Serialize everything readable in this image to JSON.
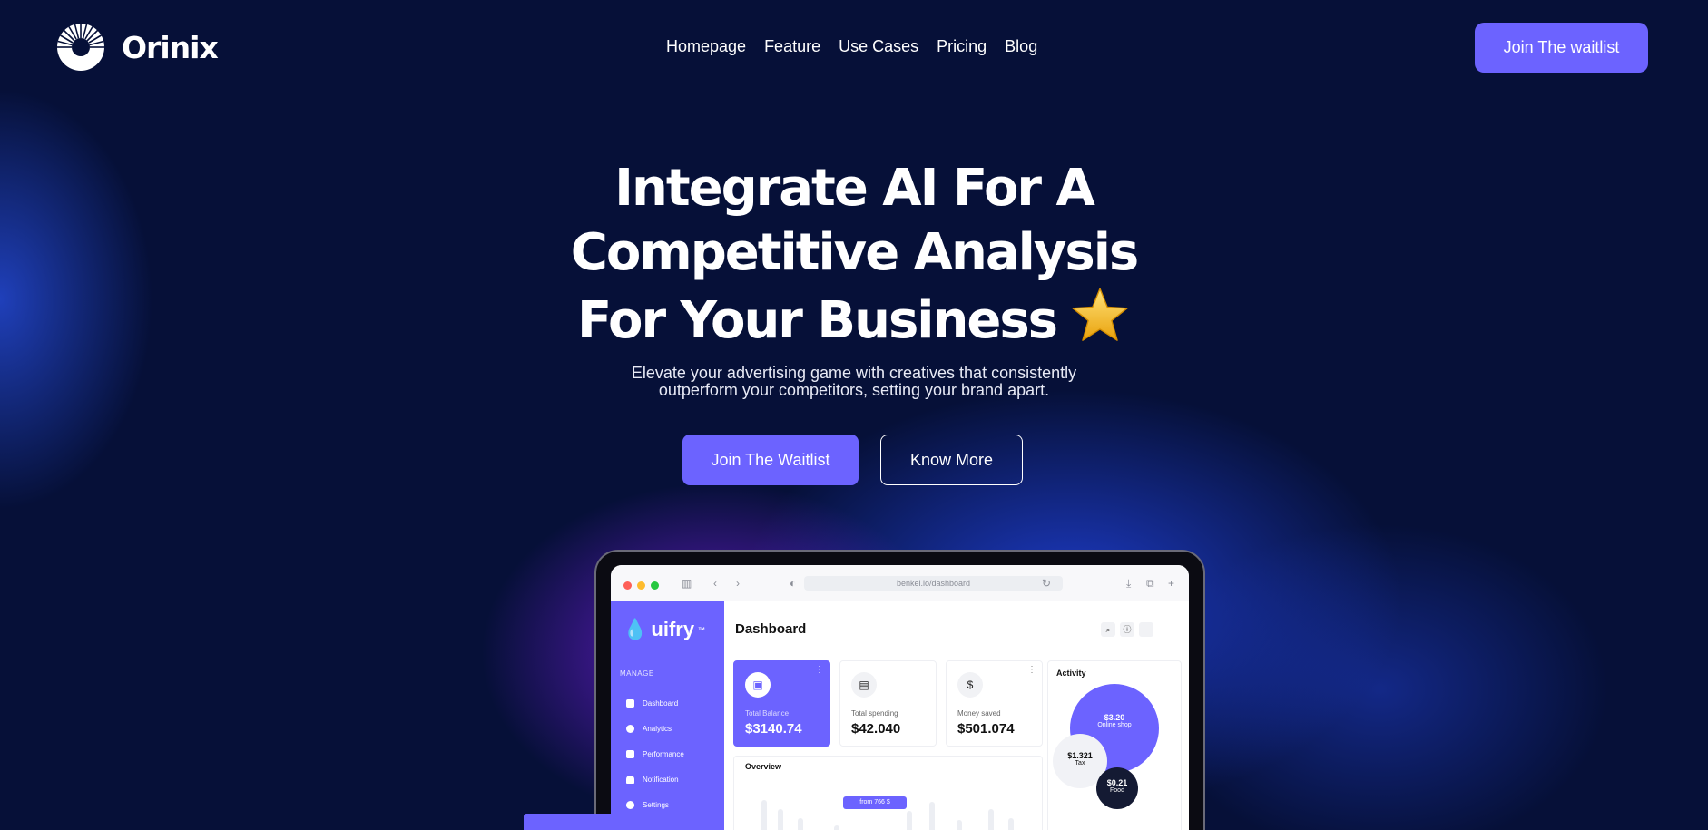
{
  "brand": {
    "name": "Orinix"
  },
  "nav": {
    "items": [
      "Homepage",
      "Feature",
      "Use Cases",
      "Pricing",
      "Blog"
    ],
    "cta_label": "Join The waitlist"
  },
  "hero": {
    "title_lines": [
      "Integrate AI For A",
      "Competitive Analysis",
      "For Your Business"
    ],
    "subtitle_lines": [
      "Elevate your advertising game with creatives that consistently",
      "outperform your competitors, setting your brand apart."
    ],
    "primary_cta": "Join The Waitlist",
    "secondary_cta": "Know More",
    "emoji_icon": "star-icon"
  },
  "dashboard": {
    "url": "benkei.io/dashboard",
    "app_name": "uifry",
    "app_trademark": "™",
    "section_label": "MANAGE",
    "sidebar_items": [
      "Dashboard",
      "Analytics",
      "Performance",
      "Notification",
      "Settings"
    ],
    "page_title": "Dashboard",
    "cards": [
      {
        "label": "Total Balance",
        "value": "$3140.74",
        "icon": "wallet-icon"
      },
      {
        "label": "Total spending",
        "value": "$42.040",
        "icon": "bag-icon"
      },
      {
        "label": "Money saved",
        "value": "$501.074",
        "icon": "dollar-icon"
      }
    ],
    "activity": {
      "title": "Activity",
      "bubbles": [
        {
          "value": "$3.20",
          "label": "Online shop"
        },
        {
          "value": "$1.321",
          "label": "Tax"
        },
        {
          "value": "$0.21",
          "label": "Food"
        }
      ]
    },
    "overview": {
      "title": "Overview",
      "tooltip": "from 766 $"
    }
  },
  "colors": {
    "background": "#061038",
    "accent": "#6c63ff",
    "glow_purple": "#7a1ee6",
    "glow_blue": "#2346eb"
  }
}
